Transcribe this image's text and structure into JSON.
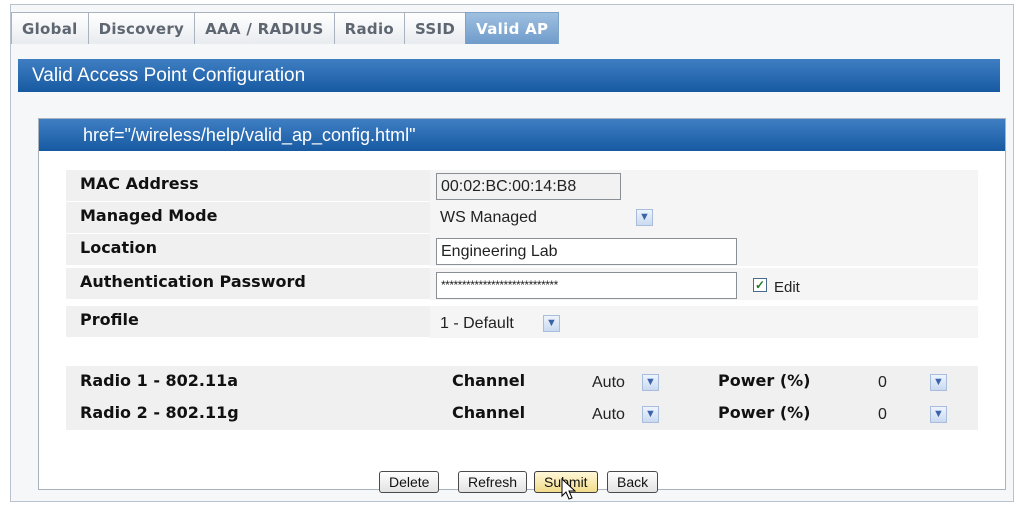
{
  "tabs": [
    {
      "label": "Global"
    },
    {
      "label": "Discovery"
    },
    {
      "label": "AAA / RADIUS"
    },
    {
      "label": "Radio"
    },
    {
      "label": "SSID"
    },
    {
      "label": "Valid AP"
    }
  ],
  "page_title": "Valid Access Point Configuration",
  "panel_title": "href=\"/wireless/help/valid_ap_config.html\"",
  "form": {
    "mac_label": "MAC Address",
    "mac_value": "00:02:BC:00:14:B8",
    "mode_label": "Managed Mode",
    "mode_value": "WS Managed",
    "location_label": "Location",
    "location_value": "Engineering Lab",
    "password_label": "Authentication Password",
    "password_value": "****************************",
    "edit_label": "Edit",
    "edit_checked": true,
    "profile_label": "Profile",
    "profile_value": "1 - Default"
  },
  "radios": [
    {
      "label": "Radio 1 - 802.11a",
      "channel_label": "Channel",
      "channel_value": "Auto",
      "power_label": "Power (%)",
      "power_value": "0"
    },
    {
      "label": "Radio 2 - 802.11g",
      "channel_label": "Channel",
      "channel_value": "Auto",
      "power_label": "Power (%)",
      "power_value": "0"
    }
  ],
  "buttons": {
    "delete": "Delete",
    "refresh": "Refresh",
    "submit": "Submit",
    "back": "Back"
  },
  "colors": {
    "header_blue": "#175aa1",
    "active_tab": "#6f9bcb"
  },
  "icons": {
    "dropdown": "chevron-down-icon",
    "checkbox": "check-icon",
    "cursor": "pointer-cursor-icon"
  }
}
